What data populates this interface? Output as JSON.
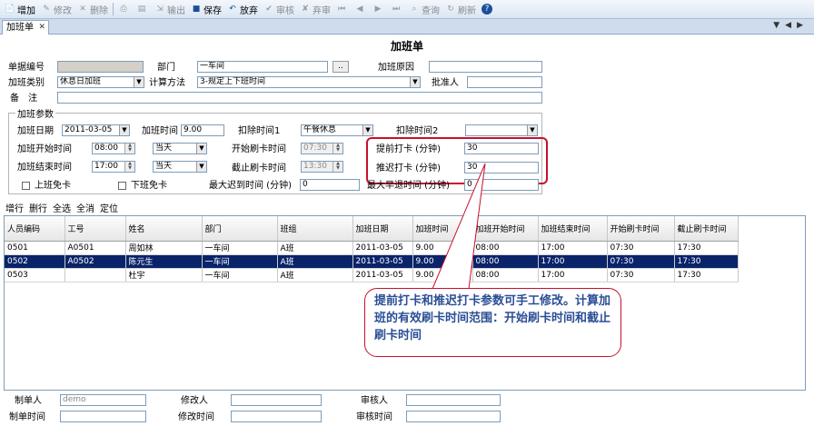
{
  "toolbar": {
    "items": [
      {
        "label": "增加",
        "icon": "add-icon",
        "enabled": true
      },
      {
        "label": "修改",
        "icon": "edit-icon",
        "enabled": false
      },
      {
        "label": "删除",
        "icon": "delete-icon",
        "enabled": false
      },
      {
        "label": "",
        "icon": "print-icon",
        "enabled": false
      },
      {
        "label": "",
        "icon": "preview-icon",
        "enabled": false
      },
      {
        "label": "输出",
        "icon": "export-icon",
        "enabled": false
      },
      {
        "label": "保存",
        "icon": "save-icon",
        "enabled": true
      },
      {
        "label": "放弃",
        "icon": "discard-icon",
        "enabled": true
      },
      {
        "label": "审核",
        "icon": "approve-icon",
        "enabled": false
      },
      {
        "label": "弃审",
        "icon": "unapprove-icon",
        "enabled": false
      },
      {
        "label": "查询",
        "icon": "query-icon",
        "enabled": false
      },
      {
        "label": "刷新",
        "icon": "refresh-icon",
        "enabled": false
      }
    ]
  },
  "tab": {
    "label": "加班单"
  },
  "form": {
    "title": "加班单",
    "doc_no_label": "单据编号",
    "doc_no_value": "",
    "dept_label": "部门",
    "dept_value": "一车间",
    "dept_btn": "..",
    "reason_label": "加班原因",
    "reason_value": "",
    "type_label": "加班类别",
    "type_value": "休息日加班",
    "calc_label": "计算方法",
    "calc_value": "3-规定上下班时间",
    "approver_label": "批准人",
    "approver_value": "",
    "remark_label": "备　注",
    "remark_value": ""
  },
  "params": {
    "group_title": "加班参数",
    "date_label": "加班日期",
    "date_value": "2011-03-05",
    "hours_label": "加班时间",
    "hours_value": "9.00",
    "deduct1_label": "扣除时间1",
    "deduct1_value": "午餐休息",
    "deduct2_label": "扣除时间2",
    "deduct2_value": "",
    "start_label": "加班开始时间",
    "start_value": "08:00",
    "start_day": "当天",
    "end_label": "加班结束时间",
    "end_value": "17:00",
    "end_day": "当天",
    "card_start_label": "开始刷卡时间",
    "card_start_value": "07:30",
    "card_end_label": "截止刷卡时间",
    "card_end_value": "13:30",
    "early_label": "提前打卡 (分钟)",
    "early_value": "30",
    "late_label": "推迟打卡 (分钟)",
    "late_value": "30",
    "on_free_label": "上班免卡",
    "off_free_label": "下班免卡",
    "max_late_label": "最大迟到时间 (分钟)",
    "max_late_value": "0",
    "max_early_label": "最大早退时间 (分钟)",
    "max_early_value": "0"
  },
  "grid_actions": [
    "增行",
    "删行",
    "全选",
    "全消",
    "定位"
  ],
  "grid": {
    "headers": [
      "人员编码",
      "工号",
      "姓名",
      "部门",
      "班组",
      "加班日期",
      "加班时间",
      "加班开始时间",
      "加班结束时间",
      "开始刷卡时间",
      "截止刷卡时间"
    ],
    "rows": [
      [
        "0501",
        "A0501",
        "周如林",
        "一车间",
        "A班",
        "2011-03-05",
        "9.00",
        "08:00",
        "17:00",
        "07:30",
        "17:30"
      ],
      [
        "0502",
        "A0502",
        "陈元生",
        "一车间",
        "A班",
        "2011-03-05",
        "9.00",
        "08:00",
        "17:00",
        "07:30",
        "17:30"
      ],
      [
        "0503",
        "",
        "杜宇",
        "一车间",
        "A班",
        "2011-03-05",
        "9.00",
        "08:00",
        "17:00",
        "07:30",
        "17:30"
      ]
    ],
    "selected_row": 1
  },
  "callout": {
    "text": "提前打卡和推迟打卡参数可手工修改。计算加班的有效刷卡时间范围：开始刷卡时间和截止刷卡时间"
  },
  "footer": {
    "maker_label": "制单人",
    "maker_value": "demo",
    "modifier_label": "修改人",
    "modifier_value": "",
    "auditor_label": "审核人",
    "auditor_value": "",
    "make_time_label": "制单时间",
    "make_time_value": "",
    "modify_time_label": "修改时间",
    "modify_time_value": "",
    "audit_time_label": "审核时间",
    "audit_time_value": ""
  },
  "colors": {
    "accent": "#0a246a",
    "highlight": "#c8102e",
    "callout_text": "#2a4e96"
  }
}
